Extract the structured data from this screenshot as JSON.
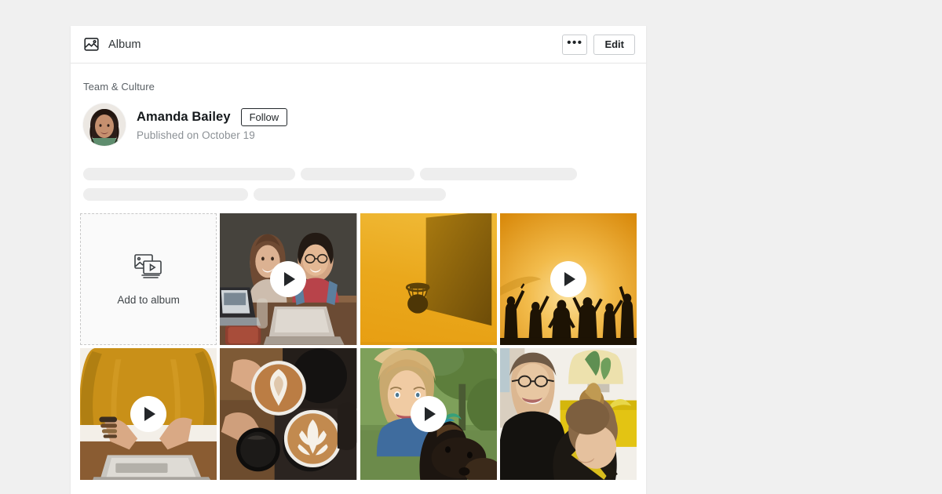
{
  "theme": {
    "page_bg": "#f0f0f0",
    "card_bg": "#ffffff",
    "accent_amber": "#e8a317",
    "text_primary": "#15191c",
    "text_muted": "#8b9095"
  },
  "header": {
    "icon": "album-image-icon",
    "title": "Album",
    "more_label": "•••",
    "edit_label": "Edit"
  },
  "content": {
    "kicker": "Team & Culture",
    "author": {
      "avatar": "avatar-amanda-bailey",
      "name": "Amanda Bailey",
      "follow_label": "Follow",
      "published": "Published on October 19"
    },
    "skeleton_rows": [
      [
        270,
        145,
        200
      ],
      [
        210,
        245
      ]
    ]
  },
  "gallery": {
    "add_tile": {
      "icon": "add-media-icon",
      "label": "Add to album"
    },
    "tiles": [
      {
        "name": "tile-two-colleagues-laptops",
        "alt": "Two colleagues laughing together at laptops",
        "kind": "video",
        "has_play": true,
        "play_icon": "play-icon"
      },
      {
        "name": "tile-basketball-hoop-sunset",
        "alt": "Basketball hoop silhouette against golden sky",
        "kind": "photo",
        "has_play": false,
        "play_icon": ""
      },
      {
        "name": "tile-crowd-silhouette-sunset",
        "alt": "Silhouettes of people cheering at sunset",
        "kind": "video",
        "has_play": true,
        "play_icon": "play-icon"
      },
      {
        "name": "tile-person-typing-sweater",
        "alt": "Person in mustard sweater typing on a laptop",
        "kind": "video",
        "has_play": true,
        "play_icon": "play-icon"
      },
      {
        "name": "tile-latte-art-coffee",
        "alt": "Hands holding cups of latte art coffee",
        "kind": "photo",
        "has_play": false,
        "play_icon": ""
      },
      {
        "name": "tile-woman-with-dog",
        "alt": "Smiling woman outdoors hugging a dachshund",
        "kind": "video",
        "has_play": true,
        "play_icon": "play-icon"
      },
      {
        "name": "tile-two-coworkers-yellow",
        "alt": "Man with glasses and woman with top knot smiling",
        "kind": "photo",
        "has_play": false,
        "play_icon": ""
      }
    ]
  }
}
